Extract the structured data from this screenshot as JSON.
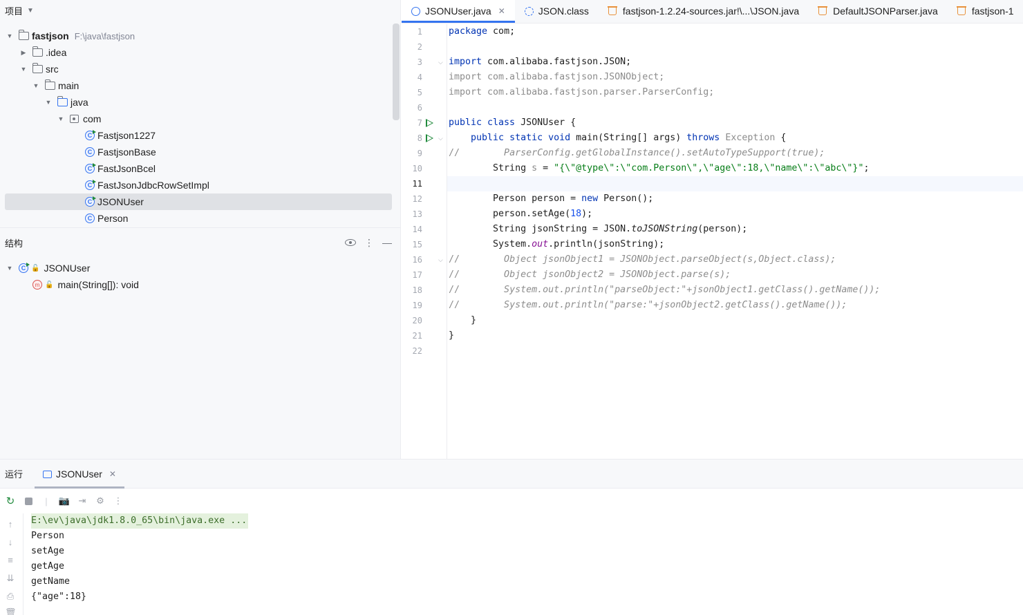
{
  "project_panel": {
    "title": "项目",
    "tree": [
      {
        "label": "fastjson",
        "path": "F:\\java\\fastjson"
      },
      {
        "label": ".idea"
      },
      {
        "label": "src"
      },
      {
        "label": "main"
      },
      {
        "label": "java"
      },
      {
        "label": "com"
      },
      {
        "label": "Fastjson1227"
      },
      {
        "label": "FastjsonBase"
      },
      {
        "label": "FastJsonBcel"
      },
      {
        "label": "FastJsonJdbcRowSetImpl"
      },
      {
        "label": "JSONUser"
      },
      {
        "label": "Person"
      }
    ]
  },
  "structure_panel": {
    "title": "结构",
    "items": [
      {
        "label": "JSONUser"
      },
      {
        "label": "main(String[]): void"
      }
    ]
  },
  "editor": {
    "tabs": [
      {
        "label": "JSONUser.java",
        "active": true
      },
      {
        "label": "JSON.class"
      },
      {
        "label": "fastjson-1.2.24-sources.jar!\\...\\JSON.java"
      },
      {
        "label": "DefaultJSONParser.java"
      },
      {
        "label": "fastjson-1"
      }
    ],
    "line_numbers": [
      "1",
      "2",
      "3",
      "4",
      "5",
      "6",
      "7",
      "8",
      "9",
      "10",
      "11",
      "12",
      "13",
      "14",
      "15",
      "16",
      "17",
      "18",
      "19",
      "20",
      "21",
      "22"
    ],
    "code": {
      "l1_kw": "package",
      "l1_rest": " com;",
      "l3_kw": "import",
      "l3_rest": " com.alibaba.fastjson.JSON;",
      "l4": "import com.alibaba.fastjson.JSONObject;",
      "l5": "import com.alibaba.fastjson.parser.ParserConfig;",
      "l7_kw": "public class",
      "l7_rest": " JSONUser {",
      "l8_indent": "    ",
      "l8_kw": "public static void",
      "l8_mid": " main(String[] args) ",
      "l8_throws": "throws",
      "l8_exc": " Exception",
      "l8_end": " {",
      "l9_slash": "//",
      "l9_body": "        ParserConfig.getGlobalInstance().setAutoTypeSupport(true);",
      "l10_pre": "        String ",
      "l10_var": "s",
      "l10_eq": " = ",
      "l10_str": "\"{\\\"@type\\\":\\\"com.Person\\\",\\\"age\\\":18,\\\"name\\\":\\\"abc\\\"}\"",
      "l10_end": ";",
      "l12_pre": "        Person person = ",
      "l12_kw": "new",
      "l12_end": " Person();",
      "l13_pre": "        person.setAge(",
      "l13_num": "18",
      "l13_end": ");",
      "l14_pre": "        String jsonString = JSON.",
      "l14_it": "toJSONString",
      "l14_end": "(person);",
      "l15_pre": "        System.",
      "l15_fld": "out",
      "l15_end": ".println(jsonString);",
      "l16_slash": "//",
      "l16_body": "        Object jsonObject1 = JSONObject.parseObject(s,Object.class);",
      "l17_slash": "//",
      "l17_body": "        Object jsonObject2 = JSONObject.parse(s);",
      "l18_slash": "//",
      "l18_body": "        System.out.println(\"parseObject:\"+jsonObject1.getClass().getName());",
      "l19_slash": "//",
      "l19_body": "        System.out.println(\"parse:\"+jsonObject2.getClass().getName());",
      "l20": "    }",
      "l21": "}"
    }
  },
  "run_panel": {
    "title": "运行",
    "tab_label": "JSONUser",
    "console": {
      "command": "E:\\ev\\java\\jdk1.8.0_65\\bin\\java.exe ...",
      "lines": [
        "Person",
        "setAge",
        "getAge",
        "getName",
        "{\"age\":18}"
      ]
    }
  },
  "colors": {
    "accent": "#3574f0",
    "keyword": "#0033b3",
    "string": "#067d17",
    "comment": "#8c8c8c",
    "run_green": "#208a3c"
  }
}
